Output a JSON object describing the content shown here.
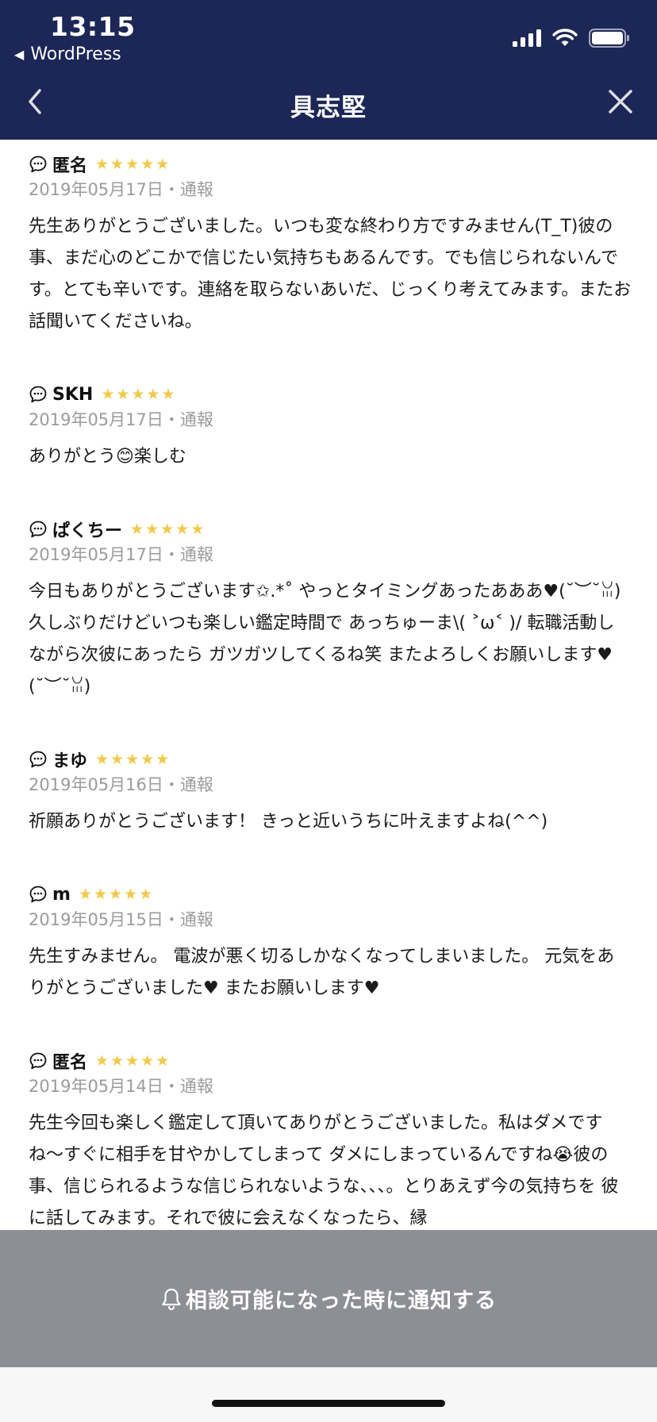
{
  "status_bar": {
    "time": "13:15",
    "back_app": "WordPress"
  },
  "nav": {
    "title": "具志堅"
  },
  "reviews": [
    {
      "name": "匿名",
      "rating": 5,
      "meta": "2019年05月17日・通報",
      "body": "先生ありがとうございました。いつも変な終わり方ですみません(T_T)彼の事、まだ心のどこかで信じたい気持ちもあるんです。でも信じられないんです。とても辛いです。連絡を取らないあいだ、じっくり考えてみます。またお話聞いてくださいね。"
    },
    {
      "name": "SKH",
      "rating": 5,
      "meta": "2019年05月17日・通報",
      "body": "ありがとう😊楽しむ"
    },
    {
      "name": "ぱくちー",
      "rating": 5,
      "meta": "2019年05月17日・通報",
      "body": "今日もありがとうございます✩.*˚ やっとタイミングあったあああ♥(˘︶˘ꈍ) 久しぶりだけどいつも楽しい鑑定時間で あっちゅーま\\( ˃ω˂ )/ 転職活動しながら次彼にあったら ガツガツしてくるね笑 またよろしくお願いします♥(˘︶˘ꈍ)"
    },
    {
      "name": "まゆ",
      "rating": 5,
      "meta": "2019年05月16日・通報",
      "body": "祈願ありがとうございます！ きっと近いうちに叶えますよね(^^)"
    },
    {
      "name": "m",
      "rating": 5,
      "meta": "2019年05月15日・通報",
      "body": "先生すみません。 電波が悪く切るしかなくなってしまいました。 元気をありがとうございました♥ またお願いします♥"
    },
    {
      "name": "匿名",
      "rating": 5,
      "meta": "2019年05月14日・通報",
      "body": "先生今回も楽しく鑑定して頂いてありがとうございました。私はダメですね〜すぐに相手を甘やかしてしまって ダメにしまっているんですね😭彼の事、信じられるような信じられないような、、、。とりあえず今の気持ちを 彼に話してみます。それで彼に会えなくなったら、縁"
    }
  ],
  "notify_button": {
    "label": "相談可能になった時に通知する"
  },
  "colors": {
    "header_bg": "#1c2657",
    "star": "#f2c94c",
    "notify_bg": "#8d8f94",
    "meta_text": "#9b9b9b"
  },
  "icons": {
    "review": "chat-bubble-icon",
    "back": "chevron-left-icon",
    "close": "close-icon",
    "notify": "bell-icon"
  }
}
